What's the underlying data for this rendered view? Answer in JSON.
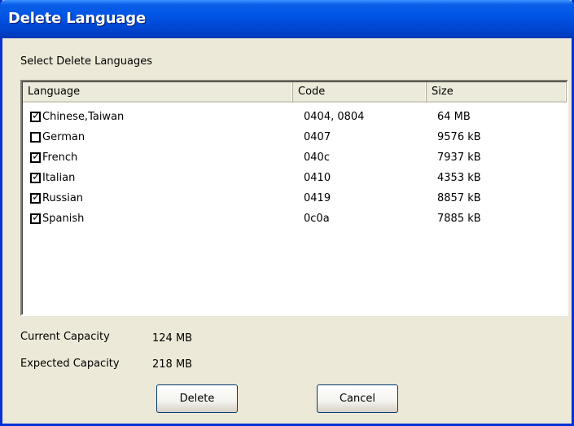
{
  "window": {
    "title": "Delete Language"
  },
  "list_caption": "Select Delete Languages",
  "columns": [
    "Language",
    "Code",
    "Size"
  ],
  "rows": [
    {
      "language": "Chinese,Taiwan",
      "code": "0404, 0804",
      "size": "64 MB",
      "checked": true
    },
    {
      "language": "German",
      "code": "0407",
      "size": "9576 kB",
      "checked": false
    },
    {
      "language": "French",
      "code": "040c",
      "size": "7937 kB",
      "checked": true
    },
    {
      "language": "Italian",
      "code": "0410",
      "size": "4353 kB",
      "checked": true
    },
    {
      "language": "Russian",
      "code": "0419",
      "size": "8857 kB",
      "checked": true
    },
    {
      "language": "Spanish",
      "code": "0c0a",
      "size": "7885 kB",
      "checked": true
    }
  ],
  "capacity": {
    "current_label": "Current Capacity",
    "current_value": "124 MB",
    "expected_label": "Expected Capacity",
    "expected_value": "218 MB"
  },
  "buttons": {
    "delete": "Delete",
    "cancel": "Cancel"
  },
  "colors": {
    "titlebar": "#0055e5",
    "dialog_bg": "#ece9d8",
    "frame": "#0831d9"
  },
  "icons": {
    "checked": "checkbox-checked-icon",
    "unchecked": "checkbox-unchecked-icon"
  }
}
